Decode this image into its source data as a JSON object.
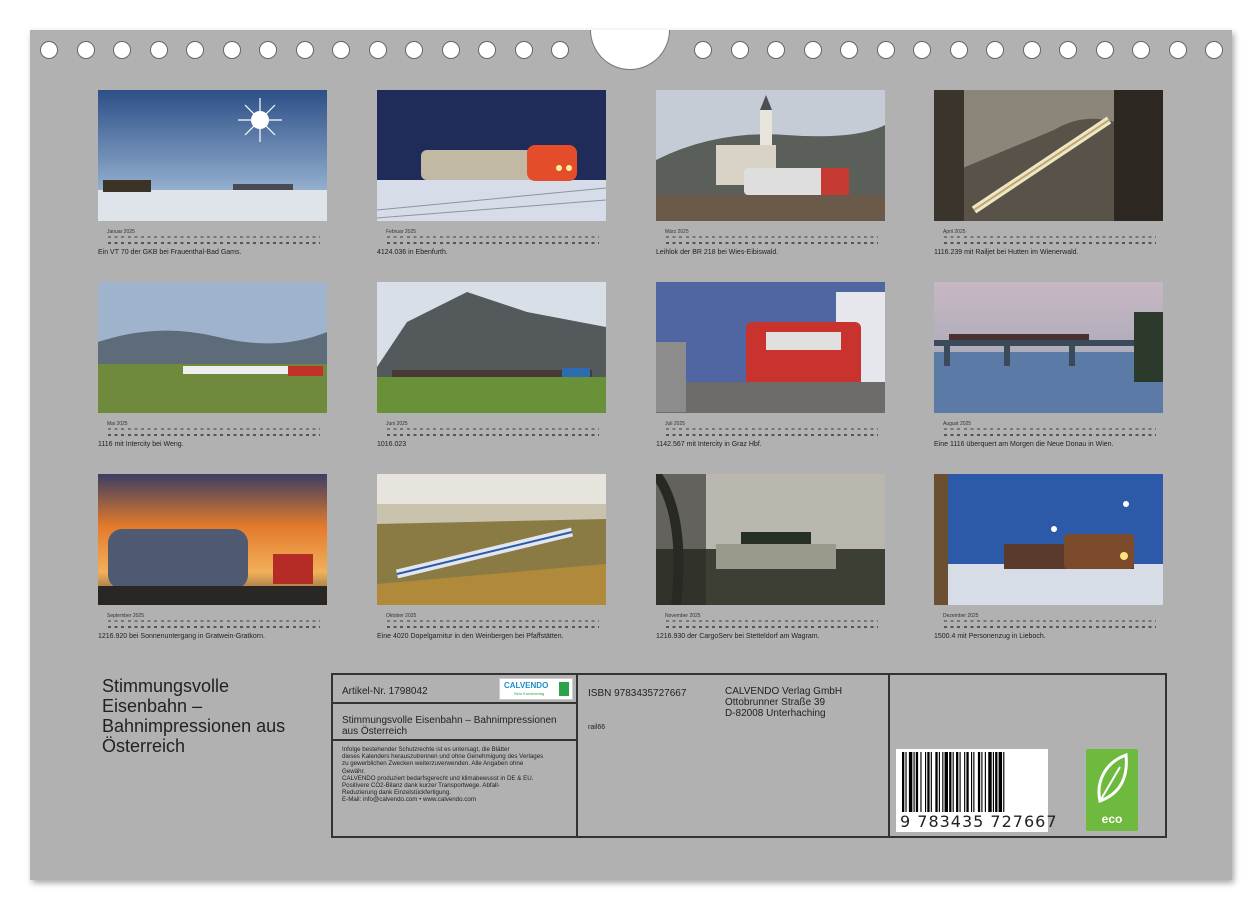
{
  "months": [
    {
      "name": "Januar 2025",
      "caption": "Ein VT 70 der GKB bei Frauenthal-Bad Gams."
    },
    {
      "name": "Februar 2025",
      "caption": "4124.036 in Ebenfurth."
    },
    {
      "name": "März 2025",
      "caption": "Leihlok der BR 218 bei Wies-Eibiswald."
    },
    {
      "name": "April 2025",
      "caption": "1116.239 mit Railjet bei Hutten im Wienerwald."
    },
    {
      "name": "Mai 2025",
      "caption": "1116 mit Intercity bei Weng."
    },
    {
      "name": "Juni 2025",
      "caption": "1016.023"
    },
    {
      "name": "Juli 2025",
      "caption": "1142.567 mit Intercity in Graz Hbf."
    },
    {
      "name": "August 2025",
      "caption": "Eine 1116 überquert am Morgen die Neue Donau in Wien."
    },
    {
      "name": "September 2025",
      "caption": "1216.920 bei Sonnenuntergang in Gratwein-Gratkorn."
    },
    {
      "name": "Oktober 2025",
      "caption": "Eine 4020 Dopelgarnitur in den Weinbergen bei Pfaffstätten."
    },
    {
      "name": "November 2025",
      "caption": "1216.930 der CargoServ bei Stetteldorf am Wagram."
    },
    {
      "name": "Dezember 2025",
      "caption": "1500.4 mit Personenzug in Lieboch."
    }
  ],
  "cover_title": "Stimmungsvolle\nEisenbahn –\nBahnimpressionen aus\nÖsterreich",
  "info": {
    "article": "Artikel-Nr. 1798042",
    "logo_name": "CALVENDO",
    "logo_sub": "Sein Kunstverlag",
    "title": "Stimmungsvolle Eisenbahn – Bahnimpressionen aus Österreich",
    "legal": "Infolge bestehender Schutzrechte ist es untersagt, die Blätter\ndieses Kalenders herauszutrennen und ohne Genehmigung des Verlages\nzu gewerblichen Zwecken weiterzuverwenden. Alle Angaben ohne\nGewähr.\nCALVENDO produziert bedarfsgerecht und klimabewusst in DE & EU.\nPositivere CO2-Bilanz dank kurzer Transportwege. Abfall-\nReduzierung dank Einzelstückfertigung.\nE-Mail: info@calvendo.com • www.calvendo.com",
    "isbn": "ISBN 9783435727667",
    "code": "rail66",
    "publisher": "CALVENDO Verlag GmbH\nOttobrunner Straße 39\nD-82008 Unterhaching",
    "barcode_number": "9 783435 727667",
    "eco_label": "eco"
  },
  "colors": {
    "sheet": "#b1b1b1",
    "eco_green": "#6dba3f",
    "calvendo_blue": "#1a8fc9"
  }
}
